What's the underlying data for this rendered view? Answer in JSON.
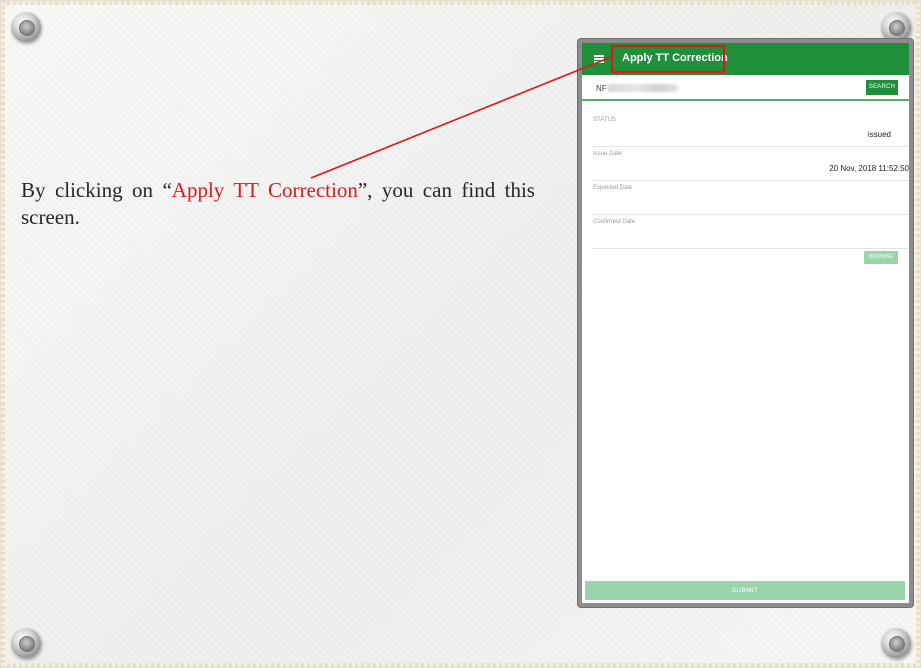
{
  "caption": {
    "before": "By clicking on “",
    "highlight": "Apply TT Correction",
    "after": "”, you can find this screen."
  },
  "app": {
    "title": "Apply TT Correction",
    "search": {
      "value": "NF",
      "button_label": "SEARCH"
    },
    "fields": [
      {
        "label": "STATUS",
        "value": "issued"
      },
      {
        "label": "Issue Date",
        "value": "20 Nov, 2018 11:52:50"
      },
      {
        "label": "Expected Date",
        "value": ""
      },
      {
        "label": "Confirmed Date",
        "value": ""
      }
    ],
    "browse_label": "BROWSE",
    "submit_label": "SUBMIT"
  },
  "colors": {
    "primary": "#1f8f3a",
    "primary_light": "#9bd3aa",
    "highlight": "#e01515",
    "caption_highlight": "#d81b1b"
  },
  "icons": [
    "hamburger-menu-icon",
    "pushpin-icon"
  ]
}
